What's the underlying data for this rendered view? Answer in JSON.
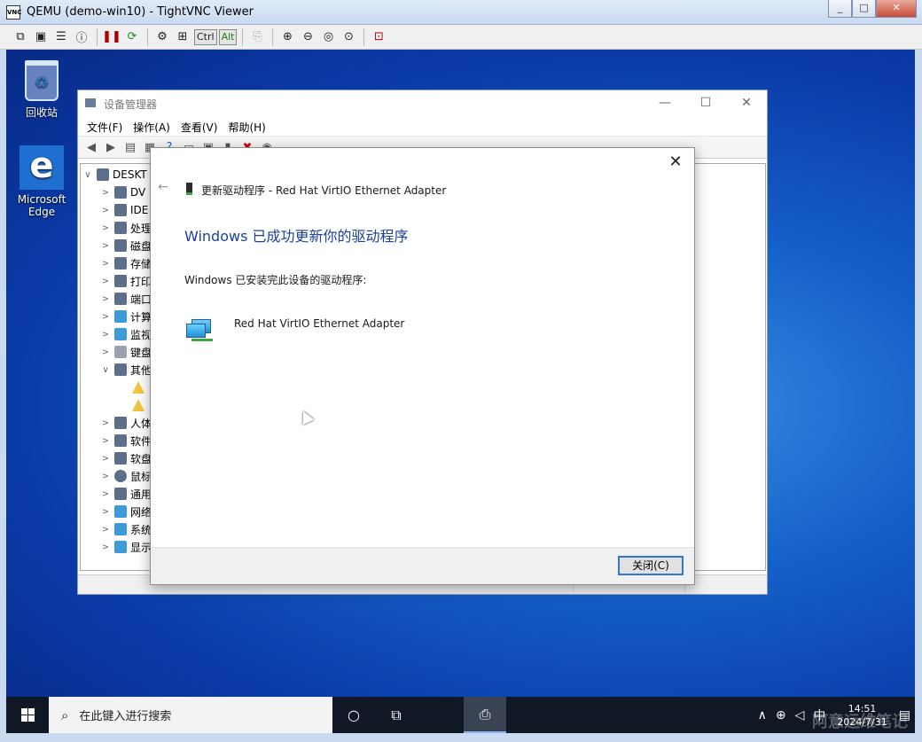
{
  "vnc": {
    "icon_text": "VNC",
    "title": "QEMU (demo-win10) - TightVNC Viewer",
    "win_buttons": [
      "_",
      "□",
      "✕"
    ],
    "toolbar": {
      "ctrl_label": "Ctrl",
      "alt_label": "Alt"
    }
  },
  "desktop": {
    "icons": [
      {
        "label": "回收站"
      },
      {
        "label": "Microsoft Edge"
      }
    ]
  },
  "devmgr": {
    "title": "设备管理器",
    "win_buttons": [
      "—",
      "☐",
      "✕"
    ],
    "menus": [
      "文件(F)",
      "操作(A)",
      "查看(V)",
      "帮助(H)"
    ],
    "tree": [
      {
        "label": "DESKT",
        "chev": "∨"
      },
      {
        "label": "DV",
        "chev": ">"
      },
      {
        "label": "IDE",
        "chev": ">"
      },
      {
        "label": "处理",
        "chev": ">"
      },
      {
        "label": "磁盘",
        "chev": ">"
      },
      {
        "label": "存储",
        "chev": ">"
      },
      {
        "label": "打印",
        "chev": ">"
      },
      {
        "label": "端口",
        "chev": ">"
      },
      {
        "label": "计算",
        "chev": ">"
      },
      {
        "label": "监视",
        "chev": ">"
      },
      {
        "label": "键盘",
        "chev": ">"
      },
      {
        "label": "其他",
        "chev": "∨"
      },
      {
        "label": "",
        "chev": ""
      },
      {
        "label": "",
        "chev": ""
      },
      {
        "label": "人体",
        "chev": ">"
      },
      {
        "label": "软件",
        "chev": ">"
      },
      {
        "label": "软盘",
        "chev": ">"
      },
      {
        "label": "鼠标",
        "chev": ">"
      },
      {
        "label": "通用",
        "chev": ">"
      },
      {
        "label": "网络",
        "chev": ">"
      },
      {
        "label": "系统",
        "chev": ">"
      },
      {
        "label": "显示",
        "chev": ">"
      }
    ]
  },
  "dialog": {
    "back_glyph": "←",
    "close_glyph": "✕",
    "header": "更新驱动程序 - Red Hat VirtIO Ethernet Adapter",
    "heading": "Windows 已成功更新你的驱动程序",
    "description": "Windows 已安装完此设备的驱动程序:",
    "device_name": "Red Hat VirtIO Ethernet Adapter",
    "close_button": "关闭(C)"
  },
  "taskbar": {
    "search_placeholder": "在此键入进行搜索",
    "tray_chevron": "∧",
    "ime": "中",
    "time": "14:51",
    "date": "2024/7/31",
    "watermark": "阿意运维笔记"
  },
  "colors": {
    "accent": "#1b3f9a",
    "desktop_blue": "#1560c8",
    "taskbar": "#101826"
  }
}
